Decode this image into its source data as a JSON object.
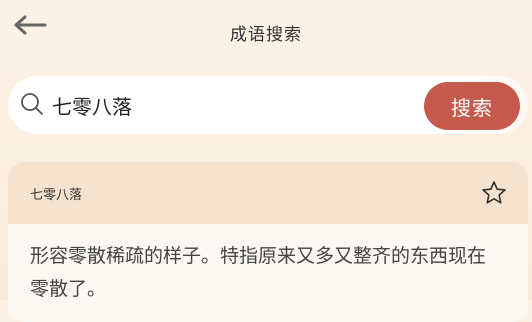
{
  "header": {
    "title": "成语搜索",
    "back_icon": "arrow-left-icon"
  },
  "search": {
    "value": "七零八落",
    "button_label": "搜索",
    "icon": "search-icon",
    "accent": "#c55a4c"
  },
  "result": {
    "name": "七零八落",
    "favorite_icon": "star-outline-icon",
    "definition": "形容零散稀疏的样子。特指原来又多又整齐的东西现在零散了。"
  }
}
